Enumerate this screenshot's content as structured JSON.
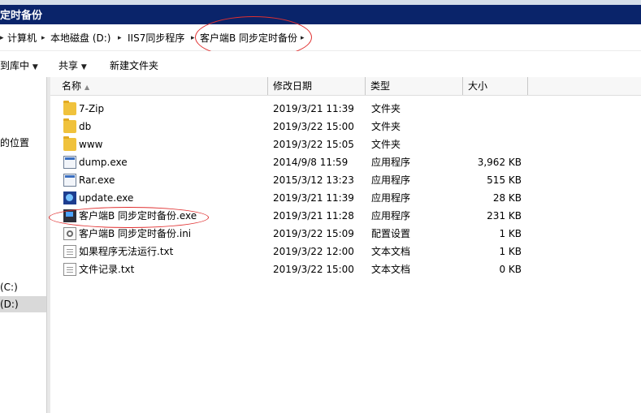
{
  "window": {
    "title": "定时备份"
  },
  "breadcrumb": [
    {
      "label": "计算机"
    },
    {
      "label": "本地磁盘 (D:)"
    },
    {
      "label": "IIS7同步程序"
    },
    {
      "label": "客户端B 同步定时备份"
    }
  ],
  "toolbar": {
    "include_library": "到库中",
    "share": "共享",
    "new_folder": "新建文件夹"
  },
  "nav": {
    "recent_places": "的位置",
    "drive_c": "(C:)",
    "drive_d": "(D:)"
  },
  "columns": {
    "name": "名称",
    "date": "修改日期",
    "type": "类型",
    "size": "大小"
  },
  "files": [
    {
      "name": "7-Zip",
      "date": "2019/3/21 11:39",
      "type": "文件夹",
      "size": "",
      "icon": "folder-icon"
    },
    {
      "name": "db",
      "date": "2019/3/22 15:00",
      "type": "文件夹",
      "size": "",
      "icon": "folder-icon"
    },
    {
      "name": "www",
      "date": "2019/3/22 15:05",
      "type": "文件夹",
      "size": "",
      "icon": "folder-icon"
    },
    {
      "name": "dump.exe",
      "date": "2014/9/8 11:59",
      "type": "应用程序",
      "size": "3,962 KB",
      "icon": "exe-icon"
    },
    {
      "name": "Rar.exe",
      "date": "2015/3/12 13:23",
      "type": "应用程序",
      "size": "515 KB",
      "icon": "exe-icon"
    },
    {
      "name": "update.exe",
      "date": "2019/3/21 11:39",
      "type": "应用程序",
      "size": "28 KB",
      "icon": "update-icon"
    },
    {
      "name": "客户端B 同步定时备份.exe",
      "date": "2019/3/21 11:28",
      "type": "应用程序",
      "size": "231 KB",
      "icon": "app-icon"
    },
    {
      "name": "客户端B 同步定时备份.ini",
      "date": "2019/3/22 15:09",
      "type": "配置设置",
      "size": "1 KB",
      "icon": "settings-file-icon"
    },
    {
      "name": "如果程序无法运行.txt",
      "date": "2019/3/22 12:00",
      "type": "文本文档",
      "size": "1 KB",
      "icon": "text-file-icon"
    },
    {
      "name": "文件记录.txt",
      "date": "2019/3/22 15:00",
      "type": "文本文档",
      "size": "0 KB",
      "icon": "text-file-icon"
    }
  ],
  "colors": {
    "title_bar": "#0a246a",
    "annotation": "#e03030",
    "folder": "#f0c23c"
  }
}
